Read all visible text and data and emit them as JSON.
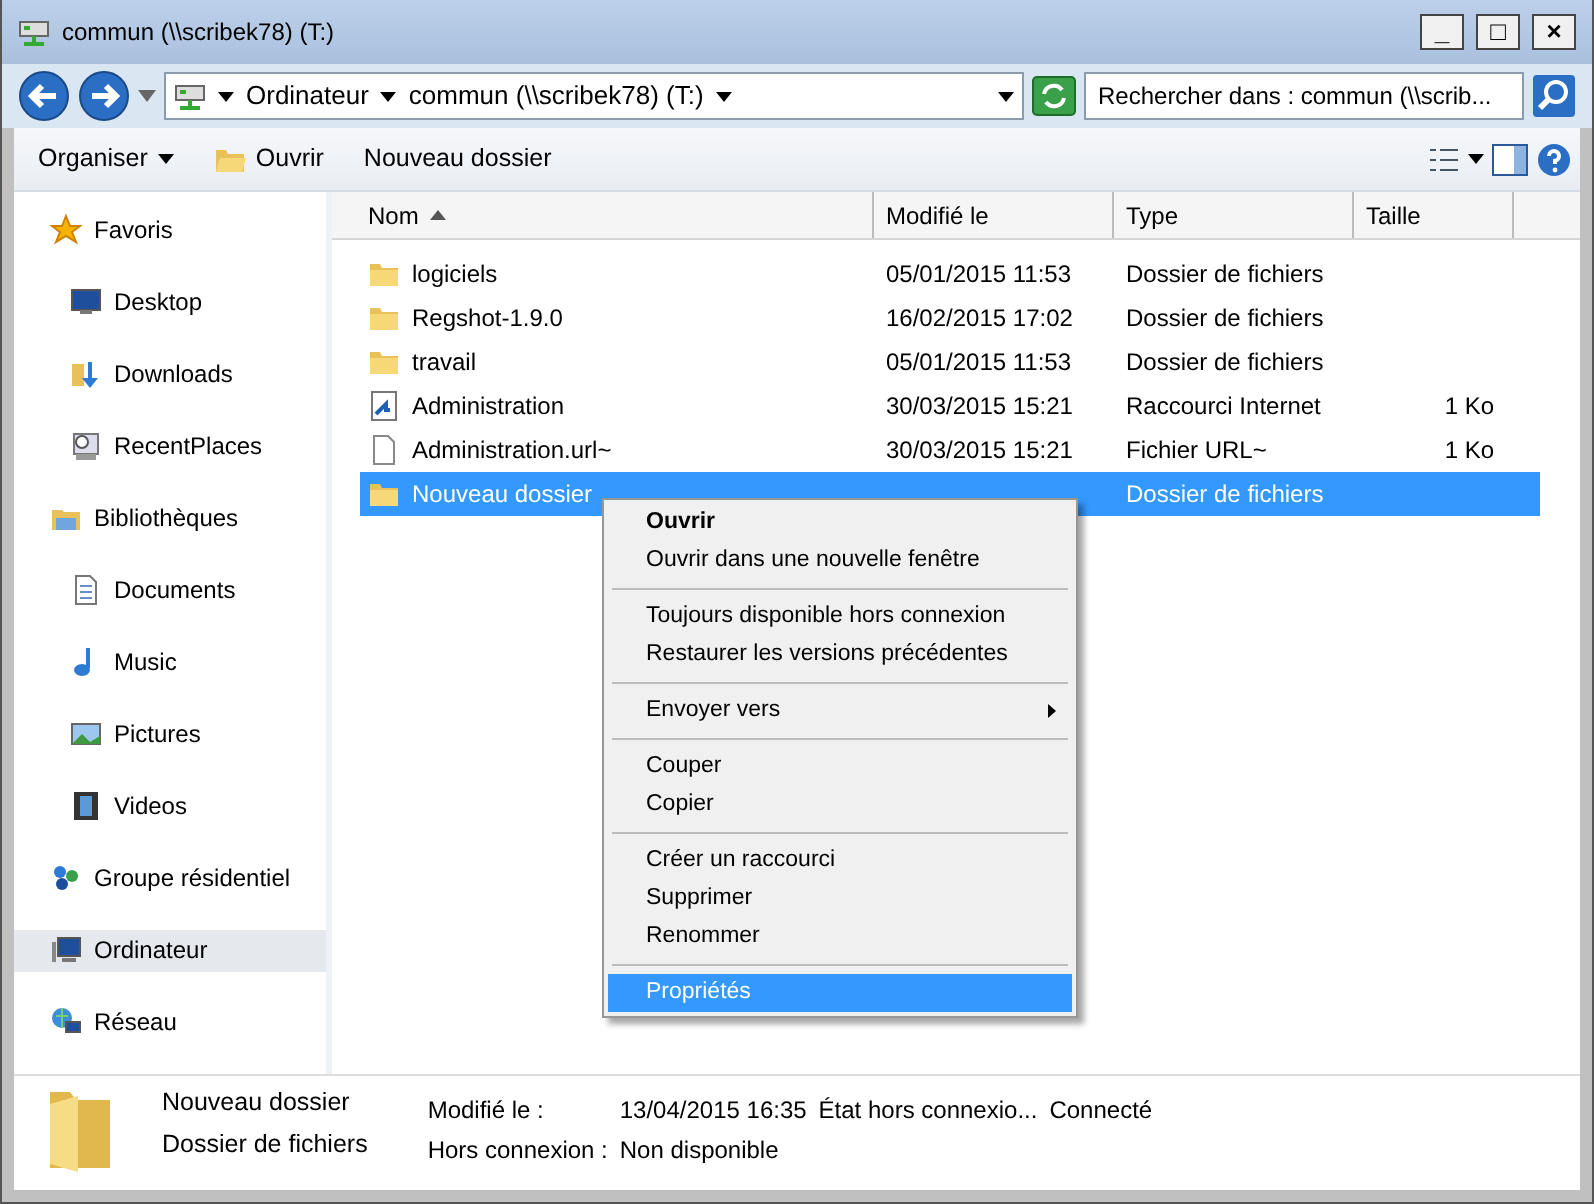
{
  "window": {
    "title": "commun (\\\\scribek78) (T:)",
    "controls": [
      "_",
      "□",
      "×"
    ]
  },
  "address": {
    "crumbs": [
      "Ordinateur",
      "commun (\\\\scribek78) (T:)"
    ],
    "search_placeholder": "Rechercher dans : commun (\\\\scrib..."
  },
  "toolbar": {
    "buttons": [
      {
        "label": "Organiser",
        "dropdown": true
      },
      {
        "label": "Ouvrir",
        "dropdown": false
      },
      {
        "label": "Nouveau dossier",
        "dropdown": false
      }
    ]
  },
  "sidebar": {
    "groups": [
      {
        "label": "Favoris",
        "selected": false,
        "children": [
          {
            "label": "Desktop",
            "selected": false
          },
          {
            "label": "Downloads",
            "selected": false
          },
          {
            "label": "RecentPlaces",
            "selected": false
          }
        ]
      },
      {
        "label": "Bibliothèques",
        "selected": false,
        "children": [
          {
            "label": "Documents",
            "selected": false
          },
          {
            "label": "Music",
            "selected": false
          },
          {
            "label": "Pictures",
            "selected": false
          },
          {
            "label": "Videos",
            "selected": false
          }
        ]
      },
      {
        "label": "Groupe résidentiel",
        "selected": false
      },
      {
        "label": "Ordinateur",
        "selected": true
      },
      {
        "label": "Réseau",
        "selected": false
      }
    ]
  },
  "table": {
    "columns": [
      {
        "label": "Nom",
        "sorted": true
      },
      {
        "label": "Modifié le",
        "sorted": false
      },
      {
        "label": "Type",
        "sorted": false
      },
      {
        "label": "Taille",
        "sorted": false
      }
    ],
    "rows": [
      {
        "kind": "folder",
        "name": "logiciels",
        "modified": "05/01/2015 11:53",
        "type": "Dossier de fichiers",
        "selected": false
      },
      {
        "kind": "folder",
        "name": "Regshot-1.9.0",
        "modified": "16/02/2015 17:02",
        "type": "Dossier de fichiers",
        "selected": false
      },
      {
        "kind": "folder",
        "name": "travail",
        "modified": "05/01/2015 11:53",
        "type": "Dossier de fichiers",
        "selected": false
      },
      {
        "kind": "shortcut",
        "name": "Administration",
        "modified": "30/03/2015 15:21",
        "type": "Raccourci Internet",
        "size": "1 Ko",
        "selected": false
      },
      {
        "kind": "file",
        "name": "Administration.url~",
        "modified": "30/03/2015 15:21",
        "type": "Fichier URL~",
        "size": "1 Ko",
        "selected": false
      },
      {
        "kind": "folder",
        "name": "Nouveau dossier",
        "type": "Dossier de fichiers",
        "selected": true
      }
    ]
  },
  "context_menu": {
    "groups": [
      [
        {
          "label": "Ouvrir",
          "default": true,
          "submenu": false,
          "selected": false
        },
        {
          "label": "Ouvrir dans une nouvelle fenêtre",
          "default": false,
          "submenu": false,
          "selected": false
        }
      ],
      [
        {
          "label": "Toujours disponible hors connexion",
          "default": false,
          "submenu": false,
          "selected": false
        },
        {
          "label": "Restaurer les versions précédentes",
          "default": false,
          "submenu": false,
          "selected": false
        }
      ],
      [
        {
          "label": "Envoyer vers",
          "default": false,
          "submenu": true,
          "selected": false
        }
      ],
      [
        {
          "label": "Couper",
          "default": false,
          "submenu": false,
          "selected": false
        },
        {
          "label": "Copier",
          "default": false,
          "submenu": false,
          "selected": false
        }
      ],
      [
        {
          "label": "Créer un raccourci",
          "default": false,
          "submenu": false,
          "selected": false
        },
        {
          "label": "Supprimer",
          "default": false,
          "submenu": false,
          "selected": false
        },
        {
          "label": "Renommer",
          "default": false,
          "submenu": false,
          "selected": false
        }
      ],
      [
        {
          "label": "Propriétés",
          "default": false,
          "submenu": false,
          "selected": true
        }
      ]
    ]
  },
  "details": {
    "name": "Nouveau dossier",
    "type": "Dossier de fichiers",
    "fields": [
      {
        "label": "Modifié le :",
        "value": "13/04/2015 16:35"
      },
      {
        "label": "État hors connexio...",
        "value": "Connecté"
      },
      {
        "label": "Hors connexion :",
        "value": "Non disponible"
      }
    ]
  }
}
